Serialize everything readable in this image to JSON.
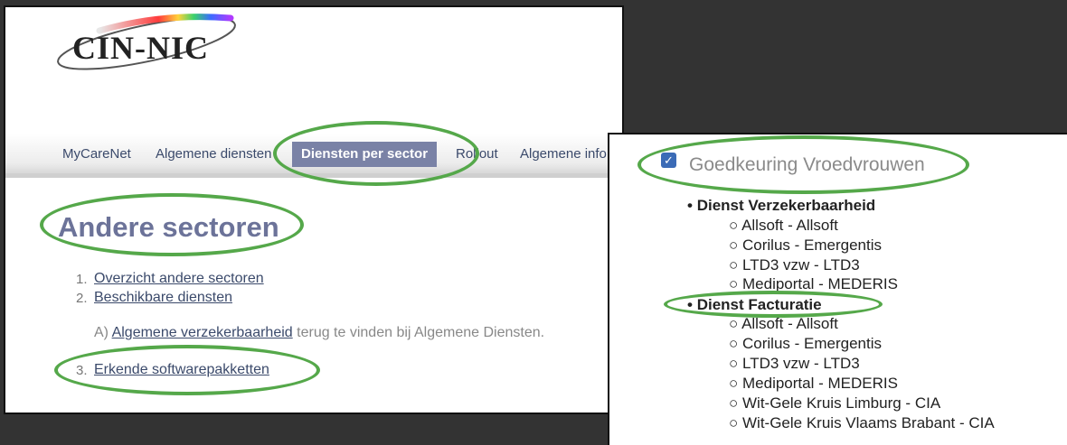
{
  "logo": {
    "text": "CIN-NIC"
  },
  "nav": {
    "items": [
      "MyCareNet",
      "Algemene diensten",
      "Diensten per sector",
      "Rollout",
      "Algemene info"
    ],
    "active_index": 2
  },
  "page": {
    "title": "Andere sectoren",
    "list": [
      {
        "num": "1.",
        "label": "Overzicht andere sectoren"
      },
      {
        "num": "2.",
        "label": "Beschikbare diensten"
      },
      {
        "num": "3.",
        "label": "Erkende softwarepakketten"
      }
    ],
    "note": {
      "prefix": "A)",
      "link": "Algemene verzekerbaarheid",
      "suffix": "terug te vinden bij Algemene Diensten."
    }
  },
  "panel2": {
    "checkbox_label": "Goedkeuring Vroedvrouwen",
    "checked": true,
    "sections": [
      {
        "title": "Dienst Verzekerbaarheid",
        "items": [
          "Allsoft - Allsoft",
          "Corilus - Emergentis",
          "LTD3 vzw - LTD3",
          "Mediportal - MEDERIS"
        ]
      },
      {
        "title": "Dienst Facturatie",
        "items": [
          "Allsoft - Allsoft",
          "Corilus - Emergentis",
          "LTD3 vzw - LTD3",
          "Mediportal - MEDERIS",
          "Wit-Gele Kruis Limburg - CIA",
          "Wit-Gele Kruis Vlaams Brabant - CIA"
        ]
      }
    ]
  },
  "colors": {
    "highlight": "#55a84a",
    "nav_active": "#7a82a6",
    "title": "#6c7399",
    "checkbox": "#3b6bb6"
  }
}
